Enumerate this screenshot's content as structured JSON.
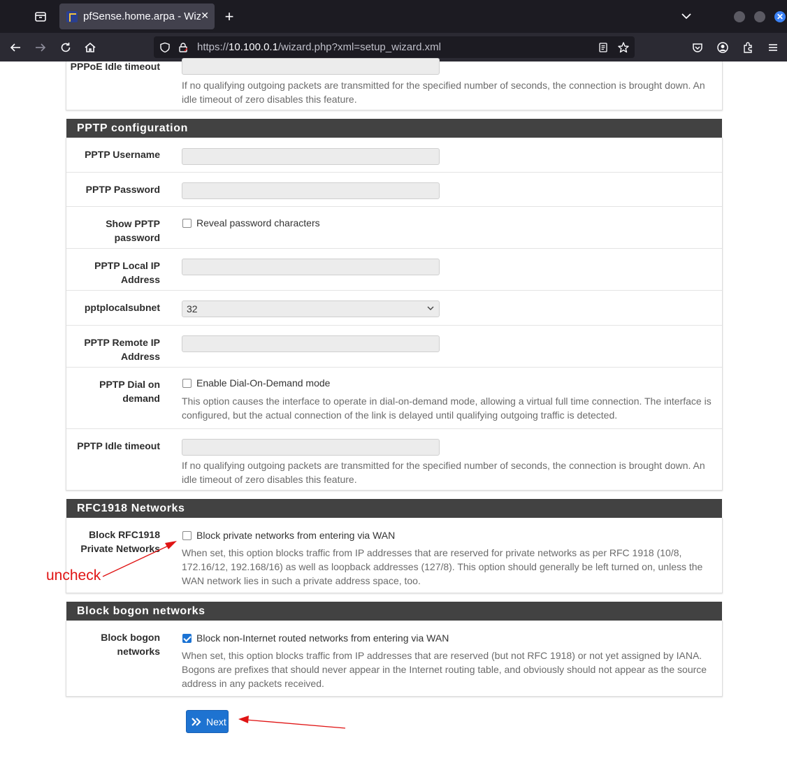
{
  "browser": {
    "tab_title": "pfSense.home.arpa - Wizard",
    "url_prefix": "https://",
    "url_host": "10.100.0.1",
    "url_path": "/wizard.php?xml=setup_wizard.xml"
  },
  "pppoe_tail": {
    "label": "PPPoE Idle timeout",
    "help": "If no qualifying outgoing packets are transmitted for the specified number of seconds, the connection is brought down. An idle timeout of zero disables this feature."
  },
  "pptp": {
    "heading": "PPTP configuration",
    "username_label": "PPTP Username",
    "password_label": "PPTP Password",
    "show_password_label": "Show PPTP password",
    "show_password_check": "Reveal password characters",
    "local_ip_label": "PPTP Local IP Address",
    "subnet_label": "pptplocalsubnet",
    "subnet_value": "32",
    "remote_ip_label": "PPTP Remote IP Address",
    "dial_label": "PPTP Dial on demand",
    "dial_check": "Enable Dial-On-Demand mode",
    "dial_help": "This option causes the interface to operate in dial-on-demand mode, allowing a virtual full time connection. The interface is configured, but the actual connection of the link is delayed until qualifying outgoing traffic is detected.",
    "idle_label": "PPTP Idle timeout",
    "idle_help": "If no qualifying outgoing packets are transmitted for the specified number of seconds, the connection is brought down. An idle timeout of zero disables this feature."
  },
  "rfc1918": {
    "heading": "RFC1918 Networks",
    "label": "Block RFC1918 Private Networks",
    "check": "Block private networks from entering via WAN",
    "checked": false,
    "help": "When set, this option blocks traffic from IP addresses that are reserved for private networks as per RFC 1918 (10/8, 172.16/12, 192.168/16) as well as loopback addresses (127/8). This option should generally be left turned on, unless the WAN network lies in such a private address space, too."
  },
  "bogon": {
    "heading": "Block bogon networks",
    "label": "Block bogon networks",
    "check": "Block non-Internet routed networks from entering via WAN",
    "checked": true,
    "help": "When set, this option blocks traffic from IP addresses that are reserved (but not RFC 1918) or not yet assigned by IANA. Bogons are prefixes that should never appear in the Internet routing table, and obviously should not appear as the source address in any packets received."
  },
  "next_button": "Next",
  "annotation": {
    "text": "uncheck",
    "color": "#e01414"
  }
}
